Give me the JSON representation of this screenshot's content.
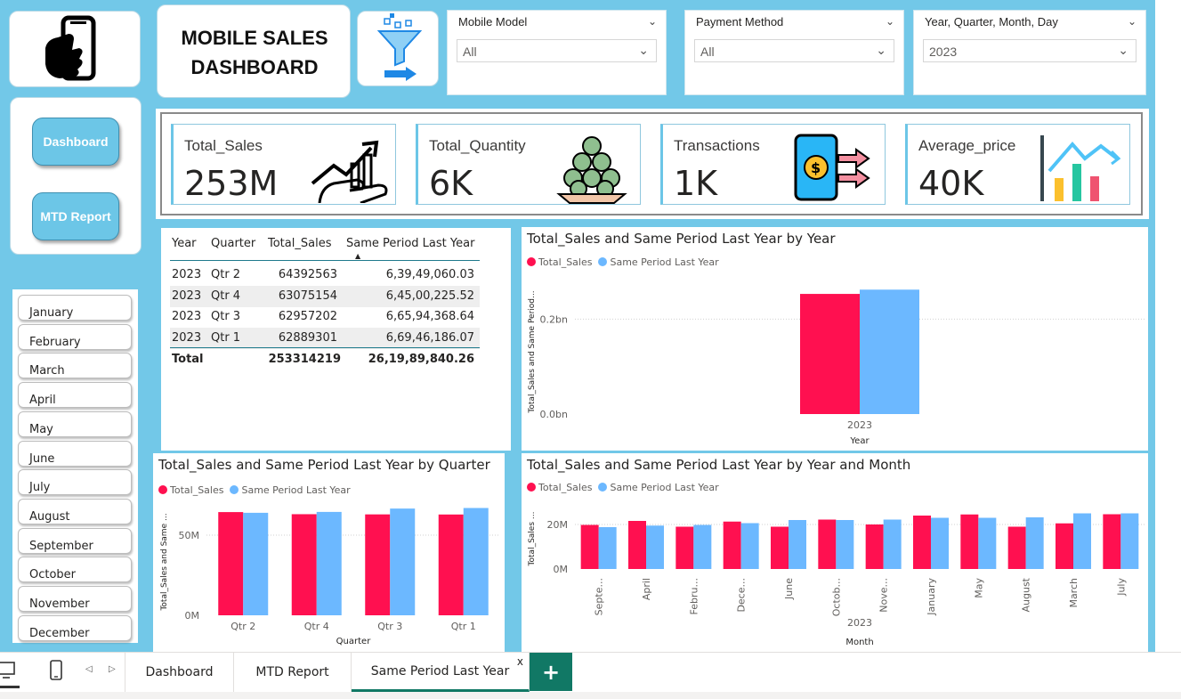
{
  "header": {
    "title_line1": "MOBILE SALES",
    "title_line2": "DASHBOARD"
  },
  "nav": {
    "dashboard": "Dashboard",
    "mtd": "MTD Report"
  },
  "filters": [
    {
      "label": "Mobile Model",
      "value": "All"
    },
    {
      "label": "Payment Method",
      "value": "All"
    },
    {
      "label": "Year, Quarter, Month, Day",
      "value": "2023"
    }
  ],
  "kpis": [
    {
      "label": "Total_Sales",
      "value": "253M",
      "icon": "growth-chart-hand-icon"
    },
    {
      "label": "Total_Quantity",
      "value": "6K",
      "icon": "coin-stack-icon"
    },
    {
      "label": "Transactions",
      "value": "1K",
      "icon": "phone-payment-icon"
    },
    {
      "label": "Average_price",
      "value": "40K",
      "icon": "bar-trend-icon"
    }
  ],
  "months": [
    "January",
    "February",
    "March",
    "April",
    "May",
    "June",
    "July",
    "August",
    "September",
    "October",
    "November",
    "December"
  ],
  "table": {
    "headers": [
      "Year",
      "Quarter",
      "Total_Sales",
      "Same Period Last Year"
    ],
    "rows": [
      [
        "2023",
        "Qtr 2",
        "64392563",
        "6,39,49,060.03"
      ],
      [
        "2023",
        "Qtr 4",
        "63075154",
        "6,45,00,225.52"
      ],
      [
        "2023",
        "Qtr 3",
        "62957202",
        "6,65,94,368.64"
      ],
      [
        "2023",
        "Qtr 1",
        "62889301",
        "6,69,46,186.07"
      ]
    ],
    "total": [
      "Total",
      "",
      "253314219",
      "26,19,89,840.26"
    ]
  },
  "colors": {
    "total_sales": "#ff1050",
    "same_period": "#6cb8ff",
    "background": "#72c8e8"
  },
  "chart_data": [
    {
      "type": "bar",
      "title": "Total_Sales and Same Period Last Year by Year",
      "xlabel": "Year",
      "ylabel": "Total_Sales and Same Period...",
      "categories": [
        "2023"
      ],
      "series": [
        {
          "name": "Total_Sales",
          "values": [
            0.253
          ]
        },
        {
          "name": "Same Period Last Year",
          "values": [
            0.262
          ]
        }
      ],
      "yticks": [
        "0.0bn",
        "0.2bn"
      ],
      "ylim": [
        0,
        0.3
      ]
    },
    {
      "type": "bar",
      "title": "Total_Sales and Same Period Last Year by Quarter",
      "xlabel": "Quarter",
      "ylabel": "Total_Sales and Same ...",
      "categories": [
        "Qtr 2",
        "Qtr 4",
        "Qtr 3",
        "Qtr 1"
      ],
      "series": [
        {
          "name": "Total_Sales",
          "values": [
            64.39,
            63.08,
            62.96,
            62.89
          ]
        },
        {
          "name": "Same Period Last Year",
          "values": [
            63.95,
            64.5,
            66.59,
            66.95
          ]
        }
      ],
      "yticks": [
        "0M",
        "50M"
      ],
      "ylim": [
        0,
        70
      ]
    },
    {
      "type": "bar",
      "title": "Total_Sales and Same Period Last Year by Year and Month",
      "xlabel": "Month",
      "xgroup": "2023",
      "ylabel": "Total_Sales ...",
      "categories": [
        "Septe...",
        "April",
        "Febru...",
        "Dece...",
        "June",
        "Octob...",
        "Nove...",
        "January",
        "May",
        "August",
        "March",
        "July"
      ],
      "series": [
        {
          "name": "Total_Sales",
          "values": [
            19.8,
            21.6,
            19.0,
            21.3,
            19.0,
            22.2,
            20.0,
            24.0,
            24.5,
            19.0,
            20.5,
            24.6
          ]
        },
        {
          "name": "Same Period Last Year",
          "values": [
            18.8,
            19.5,
            19.8,
            20.6,
            22.0,
            22.0,
            22.2,
            23.0,
            23.0,
            23.2,
            25.0,
            25.0
          ]
        }
      ],
      "yticks": [
        "0M",
        "20M"
      ],
      "ylim": [
        0,
        28
      ]
    }
  ],
  "tabs": [
    "Dashboard",
    "MTD Report",
    "Same Period Last Year"
  ],
  "tab_close": "x",
  "tab_add": "+"
}
